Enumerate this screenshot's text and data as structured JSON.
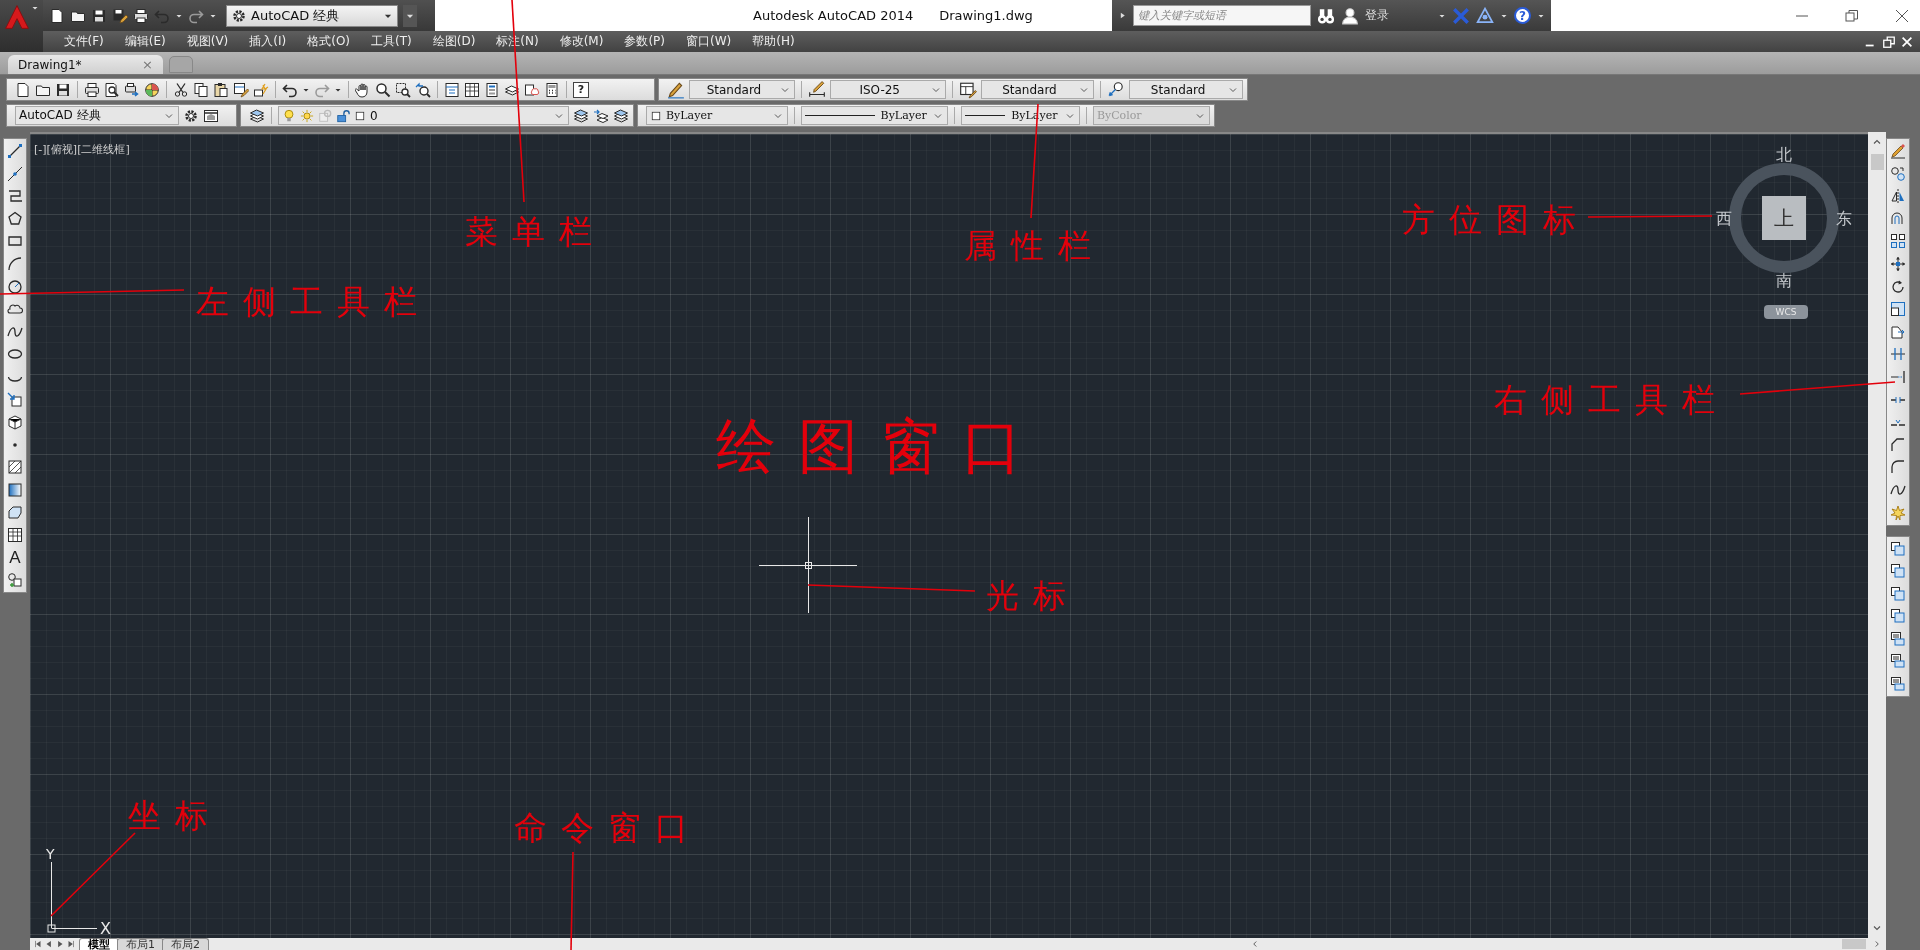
{
  "title_bar": {
    "workspace": "AutoCAD 经典",
    "app_title": "Autodesk AutoCAD 2014",
    "file_name": "Drawing1.dwg",
    "search": {
      "placeholder": "键入关键字或短语"
    },
    "sign_in": "登录",
    "help_glyph": "?"
  },
  "menu_bar": {
    "items": [
      "文件(F)",
      "编辑(E)",
      "视图(V)",
      "插入(I)",
      "格式(O)",
      "工具(T)",
      "绘图(D)",
      "标注(N)",
      "修改(M)",
      "参数(P)",
      "窗口(W)",
      "帮助(H)"
    ]
  },
  "document_tabs": [
    {
      "label": "Drawing1*",
      "close": "×",
      "selected": true
    }
  ],
  "standard_toolbar": {
    "help_glyph": "?"
  },
  "styles_toolbar": {
    "text_style": "Standard",
    "dimension_style": "ISO-25",
    "table_style": "Standard",
    "multileader_style": "Standard"
  },
  "workspaces_toolbar": {
    "workspace": "AutoCAD 经典"
  },
  "layers_toolbar": {
    "current_layer": "0"
  },
  "properties_toolbar": {
    "color_setting": "ByLayer",
    "linetype": "ByLayer",
    "lineweight": "ByLayer",
    "plot_style": {
      "value": "ByColor",
      "disabled": true
    }
  },
  "draw_toolbar": {
    "text_tool_glyph": "A"
  },
  "viewport": {
    "label": "[-][俯视][二维线框]",
    "viewcube": {
      "north": "北",
      "south": "南",
      "east": "东",
      "west": "西",
      "face": "上",
      "coordinate_system": "WCS"
    },
    "ucs": {
      "x_label": "X",
      "y_label": "Y"
    }
  },
  "annotations": [
    {
      "text": "菜单栏",
      "kind": "label"
    },
    {
      "text": "属性栏",
      "kind": "label"
    },
    {
      "text": "方位图标",
      "kind": "label"
    },
    {
      "text": "左侧工具栏",
      "kind": "label"
    },
    {
      "text": "右侧工具栏",
      "kind": "label"
    },
    {
      "text": "绘图窗口",
      "kind": "title"
    },
    {
      "text": "光标",
      "kind": "label"
    },
    {
      "text": "坐标",
      "kind": "label"
    },
    {
      "text": "命令窗口",
      "kind": "label"
    }
  ],
  "layout_tabs": [
    {
      "label": "模型",
      "selected": true
    },
    {
      "label": "布局1",
      "selected": false
    },
    {
      "label": "布局2",
      "selected": false
    }
  ]
}
